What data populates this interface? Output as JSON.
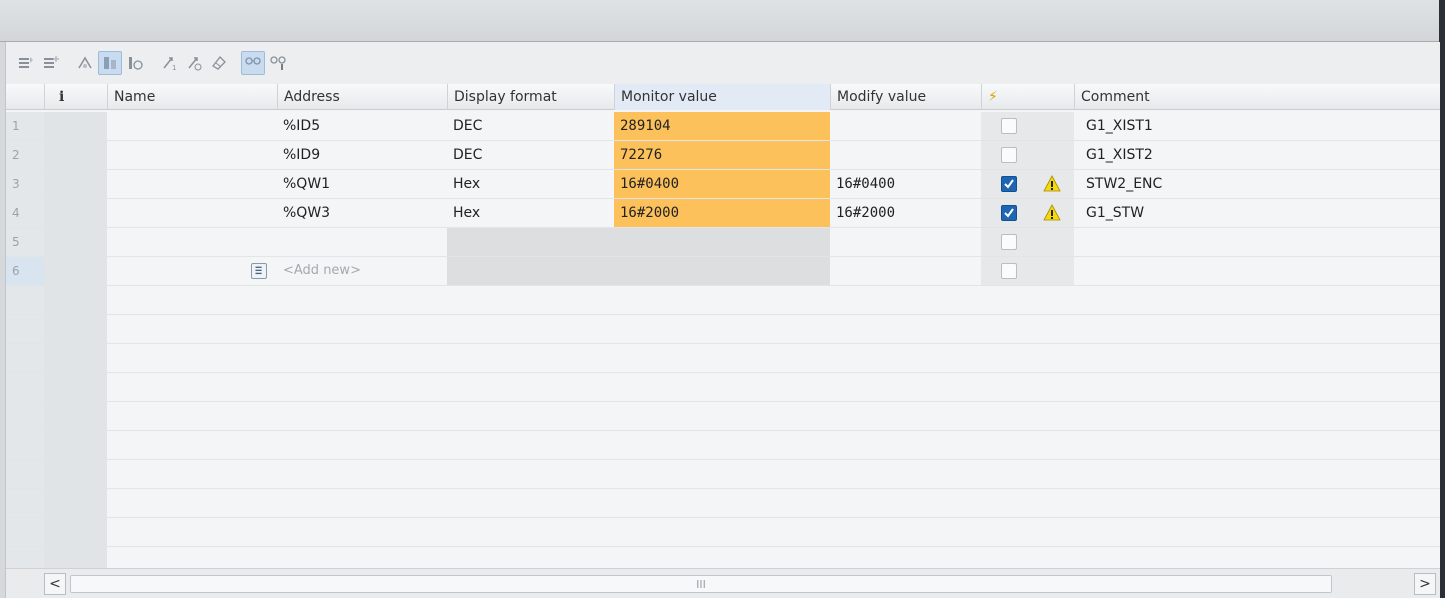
{
  "toolbar": {
    "icons": [
      "insert-row-icon",
      "add-row-icon",
      "refresh-icon",
      "monitor-all-icon",
      "monitor-now-icon",
      "modify-now-icon",
      "modify-trigger-icon",
      "enable-peripheral-icon",
      "show-hide-columns-icon",
      "show-all-icon"
    ]
  },
  "columns": {
    "info": "i",
    "name": "Name",
    "address": "Address",
    "display_format": "Display format",
    "monitor_value": "Monitor value",
    "modify_value": "Modify value",
    "modify_flag": "⚡",
    "comment": "Comment"
  },
  "rows": [
    {
      "num": "1",
      "name": "",
      "address": "%ID5",
      "display_format": "DEC",
      "monitor_value": "289104",
      "modify_value": "",
      "checked": false,
      "warn": false,
      "comment": "G1_XIST1"
    },
    {
      "num": "2",
      "name": "",
      "address": "%ID9",
      "display_format": "DEC",
      "monitor_value": "72276",
      "modify_value": "",
      "checked": false,
      "warn": false,
      "comment": "G1_XIST2"
    },
    {
      "num": "3",
      "name": "",
      "address": "%QW1",
      "display_format": "Hex",
      "monitor_value": "16#0400",
      "modify_value": "16#0400",
      "checked": true,
      "warn": true,
      "comment": "STW2_ENC"
    },
    {
      "num": "4",
      "name": "",
      "address": "%QW3",
      "display_format": "Hex",
      "monitor_value": "16#2000",
      "modify_value": "16#2000",
      "checked": true,
      "warn": true,
      "comment": "G1_STW"
    },
    {
      "num": "5",
      "name": "",
      "address": "",
      "display_format": "",
      "monitor_value": "",
      "modify_value": "",
      "checked": false,
      "warn": false,
      "comment": ""
    },
    {
      "num": "6",
      "name": "",
      "address": "<Add new>",
      "display_format": "",
      "monitor_value": "",
      "modify_value": "",
      "checked": false,
      "warn": false,
      "comment": ""
    }
  ],
  "scrollbar": {
    "left": "<",
    "right": ">",
    "thumb": "III"
  },
  "colors": {
    "monitor_highlight": "#fcc15a",
    "checkbox_on": "#1e66b4",
    "warning": "#f5d90a"
  }
}
